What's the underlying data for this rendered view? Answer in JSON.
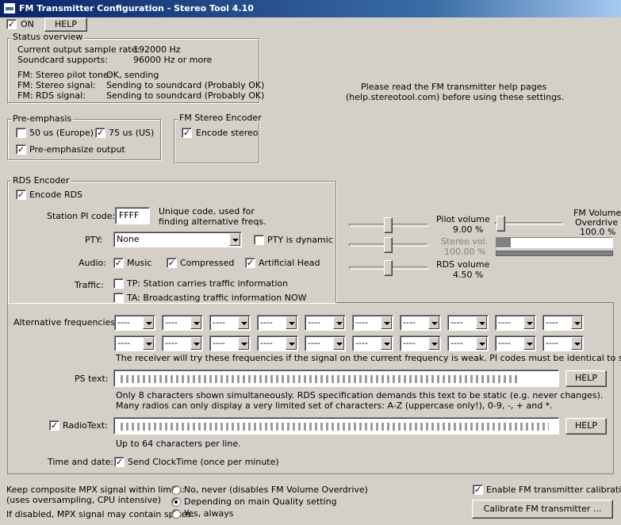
{
  "window": {
    "title": "FM Transmitter Configuration - Stereo Tool 4.10"
  },
  "top": {
    "on_label": "ON",
    "help_label": "HELP"
  },
  "status": {
    "group_label": "Status overview",
    "rows": [
      {
        "label": "Current output sample rate:",
        "value": "192000 Hz"
      },
      {
        "label": "Soundcard supports:",
        "value": "96000 Hz or more"
      },
      {
        "label": "FM: Stereo pilot tone:",
        "value": "OK, sending"
      },
      {
        "label": "FM: Stereo signal:",
        "value": "Sending to soundcard (Probably OK)"
      },
      {
        "label": "FM: RDS signal:",
        "value": "Sending to soundcard (Probably OK)"
      }
    ]
  },
  "notice": {
    "line1": "Please read the FM transmitter help pages",
    "line2": "(help.stereotool.com) before using these settings."
  },
  "preemphasis": {
    "group_label": "Pre-emphasis",
    "opt_50": "50 us (Europe)",
    "opt_75": "75 us (US)",
    "preemph_output": "Pre-emphasize output"
  },
  "stereo_encoder": {
    "group_label": "FM Stereo Encoder",
    "encode_stereo": "Encode stereo"
  },
  "rds": {
    "group_label": "RDS Encoder",
    "encode_rds": "Encode RDS",
    "pi_label": "Station PI code:",
    "pi_value": "FFFF",
    "pi_hint1": "Unique code, used for",
    "pi_hint2": "finding alternative freqs.",
    "pty_label": "PTY:",
    "pty_value": "None",
    "pty_dynamic": "PTY is dynamic",
    "audio_label": "Audio:",
    "audio_music": "Music",
    "audio_compressed": "Compressed",
    "audio_head": "Artificial Head",
    "traffic_label": "Traffic:",
    "tp_label": "TP: Station carries traffic information",
    "ta_label": "TA: Broadcasting traffic information NOW"
  },
  "levels": {
    "pilot_label": "Pilot volume",
    "pilot_value": "9.00 %",
    "stereo_label": "Stereo vol.",
    "stereo_value": "100.00 %",
    "rds_label": "RDS volume",
    "rds_value": "4.50 %",
    "overdrive_label1": "FM Volume",
    "overdrive_label2": "Overdrive",
    "overdrive_value": "100.0 %"
  },
  "af": {
    "label": "Alternative frequencies:",
    "slot_value": "----",
    "note": "The receiver will try these frequencies if the signal on the current frequency is weak. PI codes must be identical to switch."
  },
  "ps": {
    "label": "PS text:",
    "help_label": "HELP",
    "note1": "Only 8 characters shown simultaneously. RDS specification demands this text to be static (e.g. never changes).",
    "note2": "Many radios can only display a very limited set of characters: A-Z (uppercase only!), 0-9, -, + and *."
  },
  "radiotext": {
    "label": "RadioText:",
    "help_label": "HELP",
    "note": "Up to 64 characters per line."
  },
  "time": {
    "label": "Time and date:",
    "clocktime": "Send ClockTime (once per minute)"
  },
  "mpx": {
    "line1": "Keep composite MPX signal within limits:",
    "line2": "(uses oversampling, CPU intensive)",
    "line3": "If disabled, MPX signal may contain spikes.",
    "opt_never": "No, never (disables FM Volume Overdrive)",
    "opt_quality": "Depending on main Quality setting",
    "opt_always": "Yes, always"
  },
  "calibration": {
    "enable_label": "Enable FM transmitter calibration",
    "button_label": "Calibrate FM transmitter ..."
  },
  "colors": {
    "titlebar_start": "#0a246a",
    "titlebar_end": "#a6caf0",
    "window_bg": "#d4d0c8"
  },
  "levels_data": {
    "pilot_pct": 9.0,
    "stereo_pct": 100.0,
    "rds_pct": 4.5,
    "overdrive_pct": 100.0,
    "overdrive_meter_fill": 0.04
  }
}
